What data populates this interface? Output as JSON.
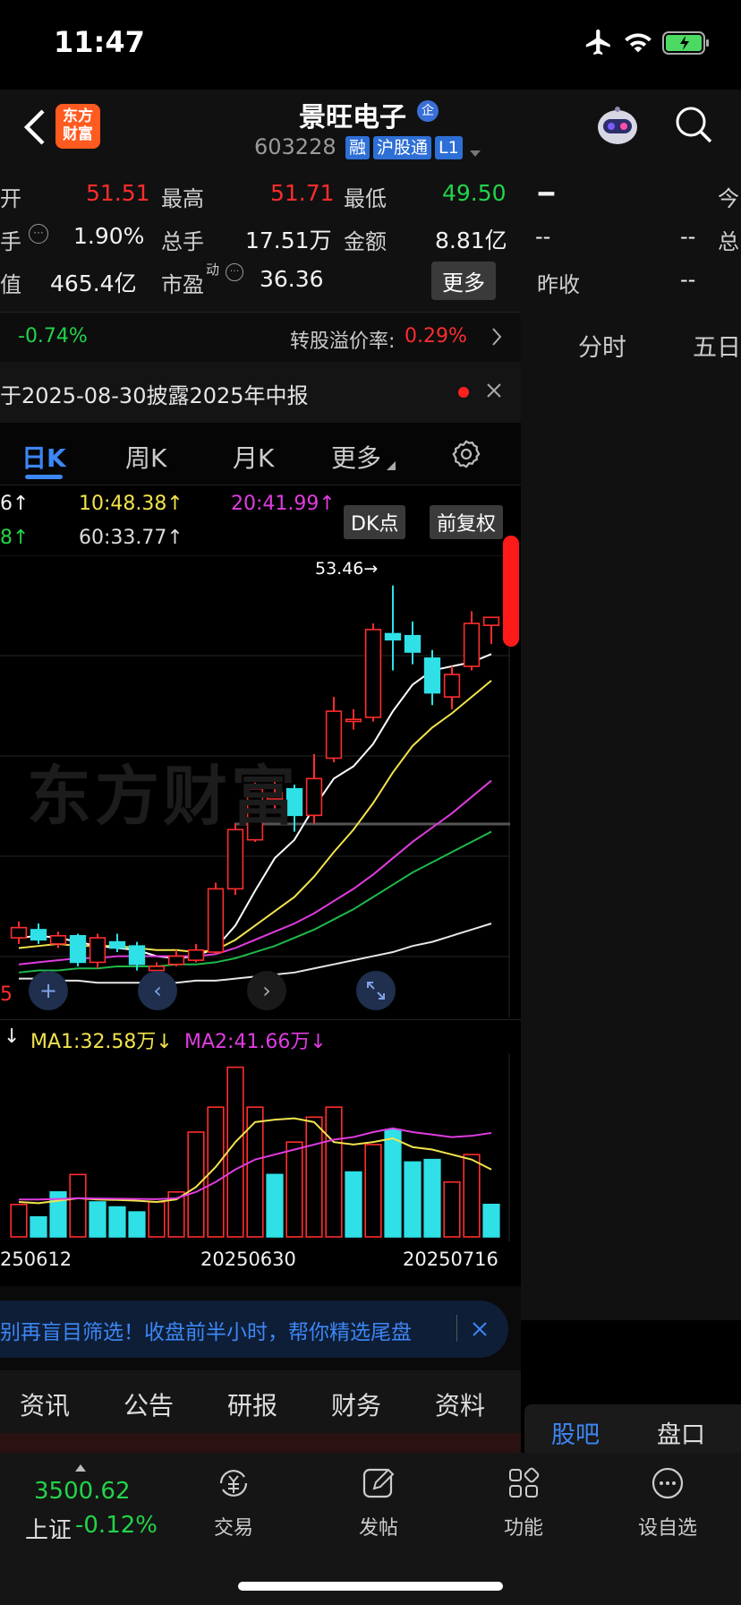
{
  "status_bar": {
    "time": "11:47"
  },
  "header": {
    "logo_text": "东方\n财富",
    "stock_name": "景旺电子",
    "name_badge": "企",
    "stock_code": "603228",
    "badges": [
      "融",
      "沪股通",
      "L1"
    ]
  },
  "quote": {
    "open_label": "开",
    "open_value": "51.51",
    "high_label": "最高",
    "high_value": "51.71",
    "low_label": "最低",
    "low_value": "49.50",
    "turnover_label": "手",
    "turnover_value": "1.90%",
    "volume_label": "总手",
    "volume_value": "17.51万",
    "amount_label": "金额",
    "amount_value": "8.81亿",
    "mktcap_label": "值",
    "mktcap_value": "465.4亿",
    "pe_label": "市盈",
    "pe_sup": "动",
    "pe_value": "36.36",
    "more_button": "更多",
    "right_dash": "--",
    "right_dash_1": "--",
    "right_dash_2": "--",
    "right_dash_3": "--",
    "right_today": "今",
    "right_total": "总",
    "prev_close_label": "昨收"
  },
  "convertible": {
    "change": "-0.74%",
    "premium_label": "转股溢价率:",
    "premium_value": "0.29%"
  },
  "notice": {
    "text": "于2025-08-30披露2025年中报"
  },
  "period_tabs": {
    "day": "日K",
    "week": "周K",
    "month": "月K",
    "more": "更多"
  },
  "right_tabs": {
    "intraday": "分时",
    "five_day": "五日"
  },
  "ma_row": {
    "ma5": "6↑",
    "ma10": "10:48.38↑",
    "ma20": "20:41.99↑",
    "ma30": "8↑",
    "ma60": "60:33.77↑",
    "dk_button": "DK点",
    "adjust_button": "前复权"
  },
  "chart_labels": {
    "high_marker": "53.46→",
    "watermark": "东方财富",
    "left_marker": "5"
  },
  "volume_header": {
    "vol_arrow": "↓",
    "ma1": "MA1:32.58万↓",
    "ma2": "MA2:41.66万↓"
  },
  "x_axis": [
    "250612",
    "20250630",
    "20250716"
  ],
  "chart_data": {
    "type": "candlestick",
    "title": "",
    "high_label": "53.46",
    "ylim": [
      33.0,
      54.5
    ],
    "candles": [
      {
        "o": 36.2,
        "c": 36.7,
        "h": 37.0,
        "l": 35.9
      },
      {
        "o": 36.6,
        "c": 36.1,
        "h": 36.9,
        "l": 35.9
      },
      {
        "o": 35.9,
        "c": 36.3,
        "h": 36.5,
        "l": 35.7
      },
      {
        "o": 36.3,
        "c": 35.0,
        "h": 36.4,
        "l": 34.8
      },
      {
        "o": 35.0,
        "c": 36.2,
        "h": 36.4,
        "l": 34.7
      },
      {
        "o": 36.0,
        "c": 35.7,
        "h": 36.4,
        "l": 35.5
      },
      {
        "o": 35.8,
        "c": 34.9,
        "h": 36.0,
        "l": 34.6
      },
      {
        "o": 34.6,
        "c": 34.8,
        "h": 35.0,
        "l": 34.5
      },
      {
        "o": 34.9,
        "c": 35.3,
        "h": 35.6,
        "l": 34.8
      },
      {
        "o": 35.1,
        "c": 35.6,
        "h": 35.9,
        "l": 35.0
      },
      {
        "o": 35.5,
        "c": 38.6,
        "h": 38.9,
        "l": 35.4
      },
      {
        "o": 38.6,
        "c": 41.5,
        "h": 41.8,
        "l": 38.3
      },
      {
        "o": 41.0,
        "c": 43.5,
        "h": 43.8,
        "l": 40.9
      },
      {
        "o": 43.0,
        "c": 43.3,
        "h": 44.0,
        "l": 42.5
      },
      {
        "o": 43.5,
        "c": 42.2,
        "h": 43.7,
        "l": 41.4
      },
      {
        "o": 42.2,
        "c": 44.0,
        "h": 45.2,
        "l": 41.8
      },
      {
        "o": 45.0,
        "c": 47.3,
        "h": 48.0,
        "l": 44.8
      },
      {
        "o": 46.8,
        "c": 46.9,
        "h": 47.4,
        "l": 46.4
      },
      {
        "o": 47.0,
        "c": 51.3,
        "h": 51.6,
        "l": 46.8
      },
      {
        "o": 51.1,
        "c": 50.8,
        "h": 53.46,
        "l": 49.3
      },
      {
        "o": 51.0,
        "c": 50.2,
        "h": 51.7,
        "l": 49.6
      },
      {
        "o": 49.9,
        "c": 48.2,
        "h": 50.3,
        "l": 47.6
      },
      {
        "o": 48.0,
        "c": 49.1,
        "h": 49.5,
        "l": 47.4
      },
      {
        "o": 49.5,
        "c": 51.6,
        "h": 52.2,
        "l": 49.3
      },
      {
        "o": 51.51,
        "c": 51.9,
        "h": 51.71,
        "l": 50.6
      }
    ],
    "ma_lines": [
      {
        "color": "#ffffff",
        "values": [
          36.2,
          36.3,
          36.2,
          36.0,
          35.8,
          35.7,
          35.6,
          35.3,
          35.2,
          35.3,
          35.7,
          36.8,
          38.5,
          40.1,
          41.0,
          42.6,
          44.0,
          44.6,
          45.7,
          47.3,
          48.6,
          49.3,
          49.5,
          49.7,
          50.1
        ]
      },
      {
        "color": "#f2e34d",
        "values": [
          35.7,
          35.8,
          35.9,
          35.8,
          35.8,
          35.8,
          35.7,
          35.6,
          35.6,
          35.5,
          35.6,
          36.1,
          36.8,
          37.5,
          38.2,
          39.2,
          40.4,
          41.5,
          42.8,
          44.3,
          45.6,
          46.5,
          47.2,
          48.0,
          48.8
        ]
      },
      {
        "color": "#e03ce0",
        "values": [
          34.9,
          35.0,
          35.1,
          35.2,
          35.2,
          35.3,
          35.3,
          35.3,
          35.3,
          35.3,
          35.4,
          35.7,
          36.1,
          36.5,
          36.9,
          37.4,
          38.0,
          38.6,
          39.3,
          40.1,
          40.9,
          41.6,
          42.3,
          43.1,
          43.9
        ]
      },
      {
        "color": "#1eb94a",
        "values": [
          34.5,
          34.6,
          34.6,
          34.7,
          34.7,
          34.8,
          34.8,
          34.8,
          34.9,
          34.9,
          35.0,
          35.2,
          35.5,
          35.8,
          36.2,
          36.6,
          37.1,
          37.6,
          38.2,
          38.8,
          39.4,
          39.9,
          40.4,
          40.9,
          41.4
        ]
      },
      {
        "color": "#e6e6e6",
        "values": [
          34.2,
          34.2,
          34.1,
          34.1,
          34.0,
          34.0,
          34.0,
          34.0,
          34.0,
          34.1,
          34.1,
          34.2,
          34.3,
          34.4,
          34.5,
          34.7,
          34.9,
          35.1,
          35.3,
          35.5,
          35.8,
          36.0,
          36.3,
          36.6,
          36.9
        ]
      }
    ],
    "volume": [
      13.0,
      8.0,
      18.0,
      25.0,
      14.0,
      12.0,
      10.0,
      14.0,
      18.0,
      42.0,
      52.0,
      68.0,
      52.0,
      25.0,
      38.0,
      48.0,
      52.0,
      26.0,
      37.0,
      43.0,
      30.0,
      31.0,
      22.0,
      33.0,
      13.0
    ],
    "volume_up": [
      true,
      false,
      false,
      true,
      false,
      false,
      false,
      true,
      true,
      true,
      true,
      true,
      true,
      false,
      true,
      true,
      true,
      false,
      true,
      false,
      false,
      false,
      true,
      true,
      false
    ],
    "volume_ma1": [
      14.0,
      13.5,
      14.5,
      15.5,
      15.0,
      14.8,
      14.5,
      14.0,
      15.0,
      20.0,
      28.0,
      38.0,
      46.0,
      47.0,
      47.5,
      46.0,
      38.0,
      37.0,
      38.0,
      39.5,
      36.0,
      35.0,
      33.0,
      31.0,
      27.0
    ],
    "volume_ma2": [
      15.0,
      15.0,
      15.2,
      15.5,
      15.4,
      15.3,
      15.2,
      15.1,
      15.5,
      18.0,
      22.0,
      27.0,
      31.0,
      33.0,
      35.0,
      37.0,
      39.0,
      40.0,
      42.0,
      43.5,
      42.0,
      41.0,
      40.0,
      40.5,
      41.66
    ]
  },
  "promo_banner": {
    "text": "别再盲目筛选！收盘前半小时，帮你精选尾盘"
  },
  "info_tabs": [
    "资讯",
    "公告",
    "研报",
    "财务",
    "资料"
  ],
  "right_bottom_tabs": {
    "guba": "股吧",
    "pankou": "盘口"
  },
  "bottom_nav": {
    "index_value": "3500.62",
    "index_name": "上证",
    "index_change": "-0.12%",
    "trade": "交易",
    "post": "发帖",
    "functions": "功能",
    "watchlist": "设自选"
  },
  "colors": {
    "up": "#ff2d2d",
    "down": "#2fe0e6",
    "accent": "#2e6fd6"
  }
}
